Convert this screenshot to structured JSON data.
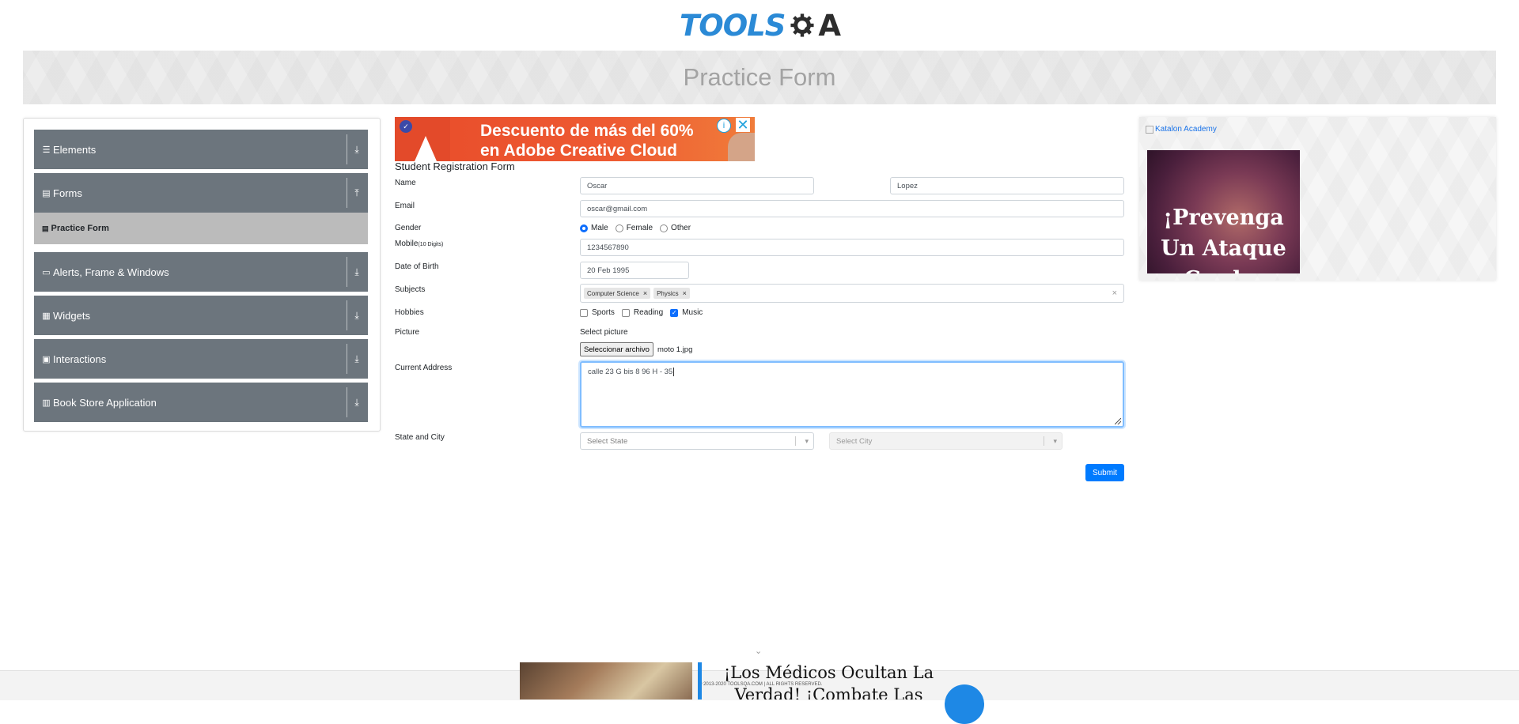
{
  "header": {
    "logo_text": "TOOLS",
    "logo_suffix": "A"
  },
  "banner": {
    "title": "Practice Form"
  },
  "sidebar": {
    "groups": [
      {
        "label": "Elements",
        "icon": "list-icon",
        "arrow": "download-icon"
      },
      {
        "label": "Forms",
        "icon": "document-icon",
        "arrow": "upload-icon"
      },
      {
        "label": "Alerts, Frame & Windows",
        "icon": "window-icon",
        "arrow": "download-icon"
      },
      {
        "label": "Widgets",
        "icon": "grid-icon",
        "arrow": "download-icon"
      },
      {
        "label": "Interactions",
        "icon": "box-icon",
        "arrow": "download-icon"
      },
      {
        "label": "Book Store Application",
        "icon": "books-icon",
        "arrow": "download-icon"
      }
    ],
    "active_item": "Practice Form"
  },
  "top_ad": {
    "line1": "Descuento de más del 60%",
    "line2": "en Adobe Creative Cloud"
  },
  "form": {
    "title": "Student Registration Form",
    "labels": {
      "name": "Name",
      "email": "Email",
      "gender": "Gender",
      "mobile": "Mobile",
      "mobile_hint": "(10 Digits)",
      "dob": "Date of Birth",
      "subjects": "Subjects",
      "hobbies": "Hobbies",
      "picture": "Picture",
      "address": "Current Address",
      "state_city": "State and City"
    },
    "first_name": "Oscar",
    "last_name": "Lopez",
    "email": "oscar@gmail.com",
    "gender_options": [
      "Male",
      "Female",
      "Other"
    ],
    "gender_selected": "Male",
    "mobile": "1234567890",
    "dob": "20 Feb 1995",
    "subjects": [
      "Computer Science",
      "Physics"
    ],
    "hobbies": [
      {
        "label": "Sports",
        "checked": false
      },
      {
        "label": "Reading",
        "checked": false
      },
      {
        "label": "Music",
        "checked": true
      }
    ],
    "picture_label": "Select picture",
    "file_button": "Seleccionar archivo",
    "file_name": "moto 1.jpg",
    "address": "calle 23 G bis 8 96 H - 35",
    "state_placeholder": "Select State",
    "city_placeholder": "Select City",
    "submit": "Submit"
  },
  "right_ad": {
    "alt_text": "Katalon Academy",
    "headline": "¡Prevenga Un Ataque Card..."
  },
  "footer": {
    "copyright": "© 2013-2020 TOOLSQA.COM | ALL RIGHTS RESERVED."
  },
  "bottom_ad": {
    "headline": "¡Los Médicos Ocultan La Verdad! ¡Combate Las"
  },
  "colors": {
    "primary": "#007bff",
    "sidebar": "#6c757d",
    "logo_blue": "#2b8ad6"
  }
}
